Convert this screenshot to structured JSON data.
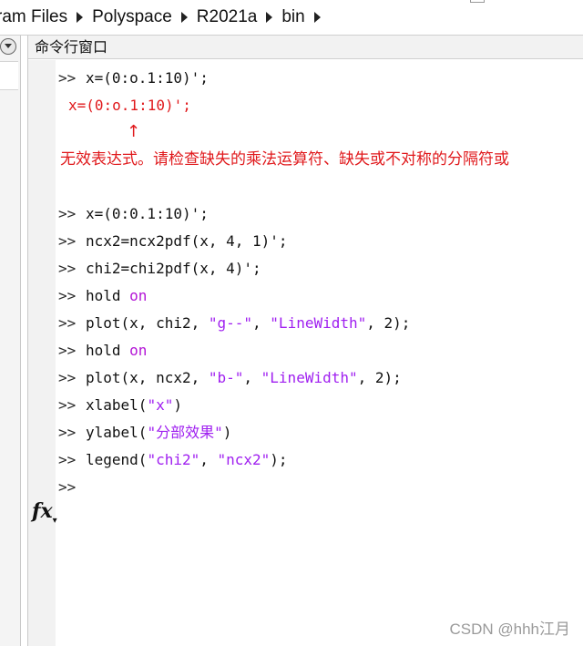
{
  "breadcrumb": {
    "items": [
      "ram Files",
      "Polyspace",
      "R2021a",
      "bin"
    ]
  },
  "command_window": {
    "title": "命令行窗口",
    "prompt": ">>",
    "fx_label": "fx",
    "lines": {
      "l1": {
        "code": "x=(0:o.1:10)';"
      },
      "err_echo": "x=(0:o.1:10)';",
      "err_caret": "↑",
      "err_msg": "无效表达式。请检查缺失的乘法运算符、缺失或不对称的分隔符或",
      "l2": {
        "code": "x=(0:0.1:10)';"
      },
      "l3": {
        "code": "ncx2=ncx2pdf(x, 4, 1)';"
      },
      "l4": {
        "code": "chi2=chi2pdf(x, 4)';"
      },
      "l5": {
        "pre": "hold ",
        "kw": "on"
      },
      "l6": {
        "pre": "plot(x, chi2, ",
        "s1": "\"g--\"",
        "mid": ", ",
        "s2": "\"LineWidth\"",
        "post": ", 2);"
      },
      "l7": {
        "pre": "hold ",
        "kw": "on"
      },
      "l8": {
        "pre": "plot(x, ncx2, ",
        "s1": "\"b-\"",
        "mid": ", ",
        "s2": "\"LineWidth\"",
        "post": ", 2);"
      },
      "l9": {
        "pre": "xlabel(",
        "s1": "\"x\"",
        "post": ")"
      },
      "l10": {
        "pre": "ylabel(",
        "s1": "\"分部效果\"",
        "post": ")"
      },
      "l11": {
        "pre": "legend(",
        "s1": "\"chi2\"",
        "mid": ", ",
        "s2": "\"ncx2\"",
        "post": ");"
      }
    }
  },
  "watermark": "CSDN @hhh江月",
  "icons": {
    "breadcrumb_separator": "triangle-right-icon",
    "pane_menu": "chevron-down-icon",
    "fx": "function-icon"
  }
}
